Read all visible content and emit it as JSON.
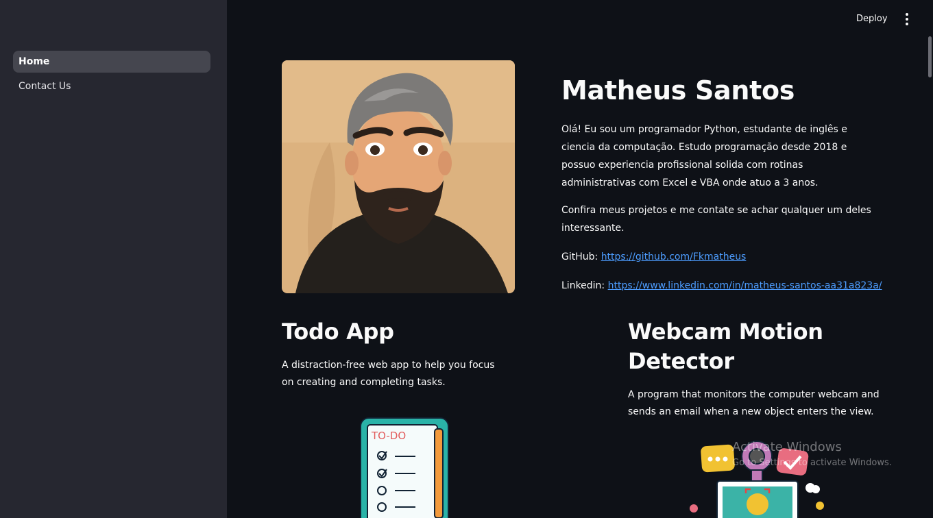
{
  "sidebar": {
    "items": [
      {
        "label": "Home",
        "active": true
      },
      {
        "label": "Contact Us",
        "active": false
      }
    ]
  },
  "header": {
    "deploy_label": "Deploy",
    "menu_icon": "vertical-ellipsis-icon"
  },
  "profile": {
    "name": "Matheus Santos",
    "bio": "Olá! Eu sou um programador Python, estudante de inglês e ciencia da computação. Estudo programação desde 2018 e possuo experiencia profissional solida com rotinas administrativas com Excel e VBA onde atuo a 3 anos.",
    "cta": "Confira meus projetos e me contate se achar qualquer um deles interessante.",
    "github_label": "GitHub:",
    "github_url": "https://github.com/Fkmatheus",
    "linkedin_label": "Linkedin:",
    "linkedin_url": "https://www.linkedin.com/in/matheus-santos-aa31a823a/"
  },
  "projects": [
    {
      "title": "Todo App",
      "description": "A distraction-free web app to help you focus on creating and completing tasks.",
      "image_text": "TO-DO"
    },
    {
      "title_line1": "Webcam Motion",
      "title_line2": "Detector",
      "description": "A program that monitors the computer webcam and sends an email when a new object enters the view."
    }
  ],
  "watermark": {
    "title": "Activate Windows",
    "subtitle": "Go to Settings to activate Windows."
  },
  "colors": {
    "background": "#0e1117",
    "sidebar": "#262730",
    "link": "#4d9dff"
  }
}
